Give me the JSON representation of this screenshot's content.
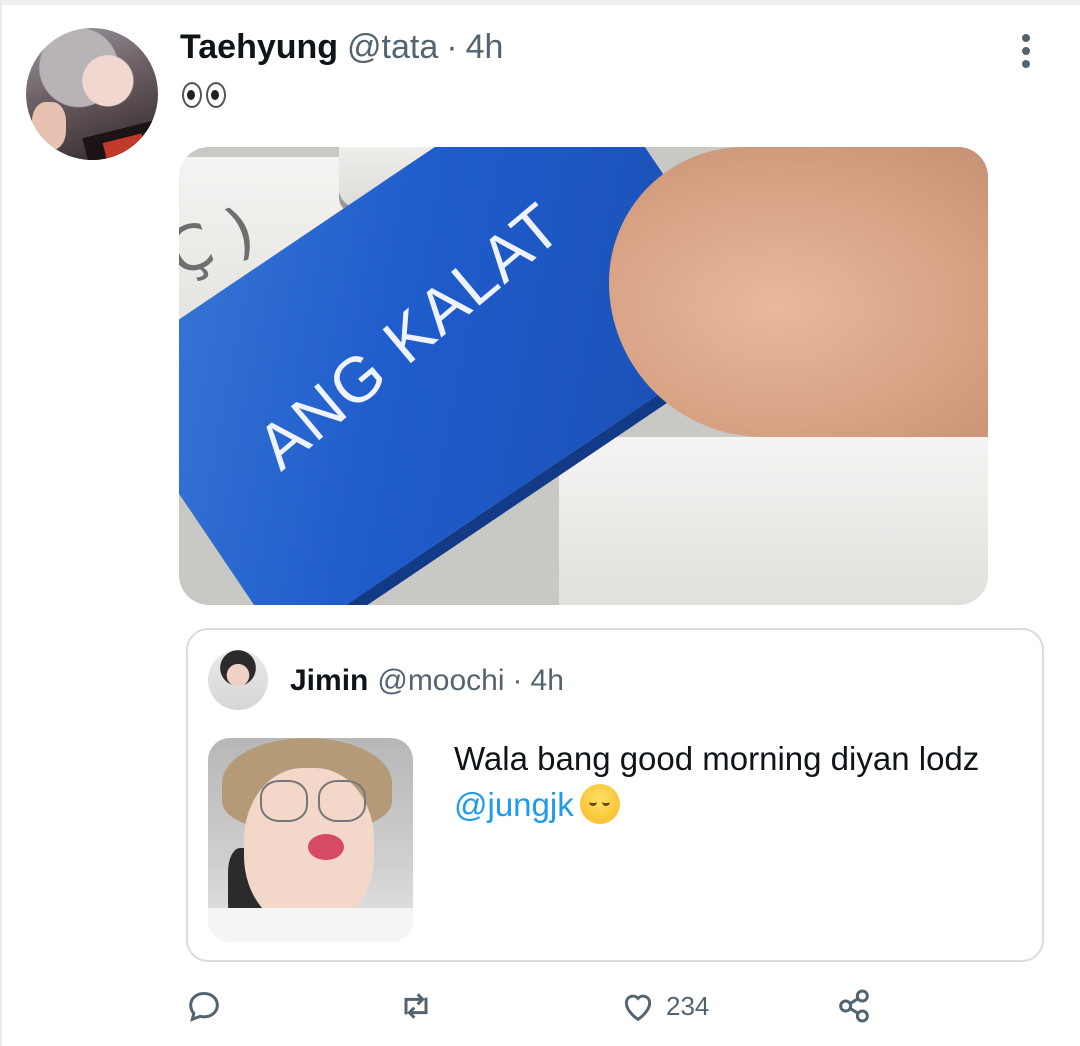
{
  "tweet": {
    "author": {
      "name": "Taehyung",
      "handle": "@tata",
      "separator": "·",
      "time": "4h"
    },
    "text": "👀",
    "media": {
      "key_label": "ANG KALAT"
    }
  },
  "quote": {
    "author": {
      "name": "Jimin",
      "handle": "@moochi",
      "separator": "·",
      "time": "4h"
    },
    "text_main": "Wala bang good morning diyan lodz ",
    "mention": "@jungjk"
  },
  "actions": {
    "reply": {
      "icon": "reply-icon"
    },
    "retweet": {
      "icon": "retweet-icon"
    },
    "like": {
      "icon": "heart-icon",
      "count": "234"
    },
    "share": {
      "icon": "share-icon"
    }
  },
  "colors": {
    "link": "#1d9bf0",
    "muted": "#536471",
    "text": "#0f1419"
  }
}
